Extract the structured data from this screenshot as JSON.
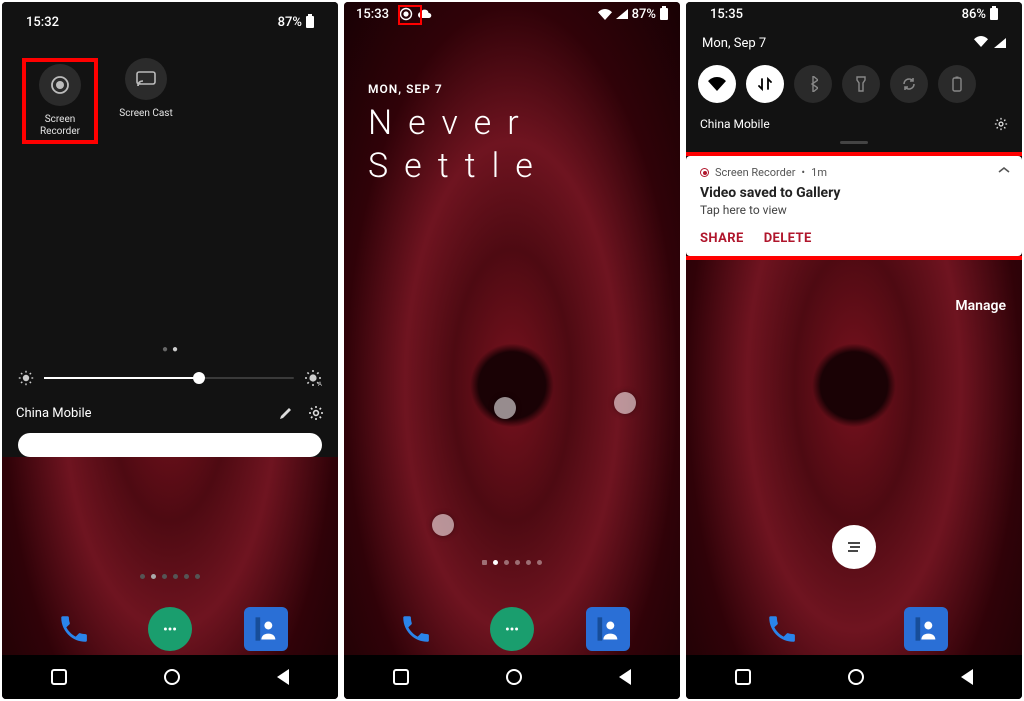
{
  "panel1": {
    "time": "15:32",
    "battery": "87%",
    "tiles": [
      {
        "label": "Screen Recorder"
      },
      {
        "label": "Screen Cast"
      }
    ],
    "carrier": "China Mobile"
  },
  "panel2": {
    "time": "15:33",
    "battery": "87%",
    "date": "MON, SEP 7",
    "line1": "Never",
    "line2": "Settle"
  },
  "panel3": {
    "time": "15:35",
    "battery": "86%",
    "date": "Mon, Sep 7",
    "carrier": "China Mobile",
    "notif": {
      "app": "Screen Recorder",
      "age": "1m",
      "title": "Video saved to Gallery",
      "subtitle": "Tap here to view",
      "share": "SHARE",
      "delete": "DELETE"
    },
    "manage": "Manage"
  }
}
